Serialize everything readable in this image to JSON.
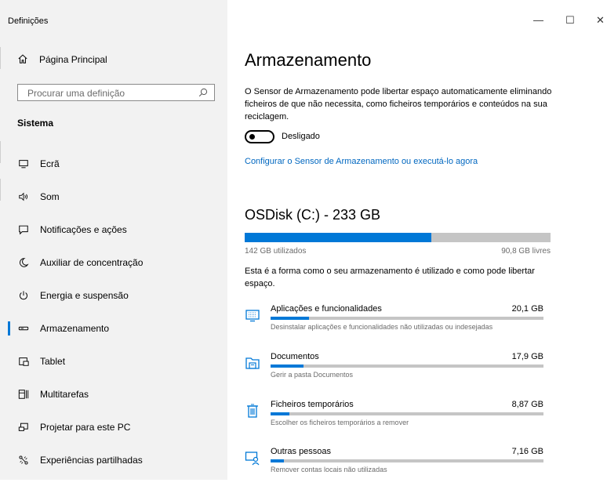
{
  "window": {
    "title": "Definições",
    "minimize": "—",
    "maximize": "☐",
    "close": "✕"
  },
  "sidebar": {
    "home_label": "Página Principal",
    "search_placeholder": "Procurar uma definição",
    "section": "Sistema",
    "items": [
      {
        "label": "Ecrã",
        "icon": "display-icon"
      },
      {
        "label": "Som",
        "icon": "speaker-icon"
      },
      {
        "label": "Notificações e ações",
        "icon": "notification-icon"
      },
      {
        "label": "Auxiliar de concentração",
        "icon": "moon-icon"
      },
      {
        "label": "Energia e suspensão",
        "icon": "power-icon"
      },
      {
        "label": "Armazenamento",
        "icon": "storage-icon",
        "active": true
      },
      {
        "label": "Tablet",
        "icon": "tablet-icon"
      },
      {
        "label": "Multitarefas",
        "icon": "multitask-icon"
      },
      {
        "label": "Projetar para este PC",
        "icon": "project-icon"
      },
      {
        "label": "Experiências partilhadas",
        "icon": "shared-icon"
      }
    ],
    "accent_color": "#0078d7"
  },
  "main": {
    "title": "Armazenamento",
    "description": "O Sensor de Armazenamento pode libertar espaço automaticamente eliminando ficheiros de que não necessita, como ficheiros temporários e conteúdos na sua reciclagem.",
    "toggle_state": "Desligado",
    "configure_link": "Configurar o Sensor de Armazenamento ou executá-lo agora",
    "disk": {
      "title": "OSDisk (C:) - 233 GB",
      "used_label": "142 GB utilizados",
      "free_label": "90,8 GB livres",
      "used_fraction": 0.61
    },
    "usage_info": "Esta é a forma como o seu armazenamento é utilizado e como pode libertar espaço.",
    "categories": [
      {
        "name": "Aplicações e funcionalidades",
        "size": "20,1 GB",
        "sub": "Desinstalar aplicações e funcionalidades não utilizadas ou indesejadas",
        "fraction": 0.14,
        "icon": "apps-icon"
      },
      {
        "name": "Documentos",
        "size": "17,9 GB",
        "sub": "Gerir a pasta Documentos",
        "fraction": 0.12,
        "icon": "documents-icon"
      },
      {
        "name": "Ficheiros temporários",
        "size": "8,87 GB",
        "sub": "Escolher os ficheiros temporários a remover",
        "fraction": 0.07,
        "icon": "trash-icon"
      },
      {
        "name": "Outras pessoas",
        "size": "7,16 GB",
        "sub": "Remover contas locais não utilizadas",
        "fraction": 0.05,
        "icon": "people-icon"
      }
    ]
  }
}
